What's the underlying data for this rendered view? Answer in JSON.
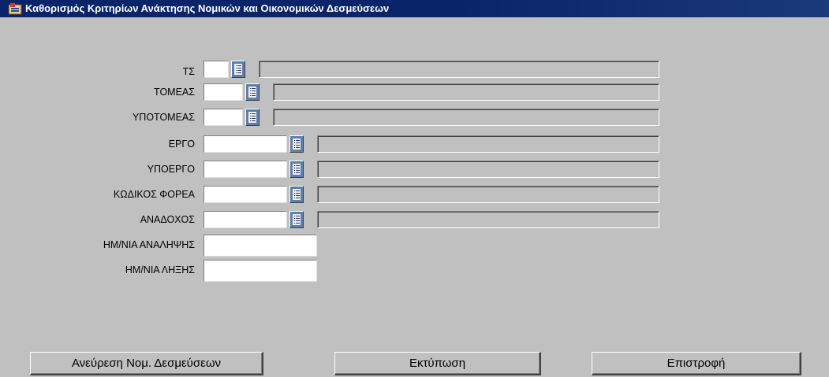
{
  "window": {
    "title": "Καθορισμός Κριτηρίων Ανάκτησης Νομικών και Οικονομικών Δεσμεύσεων",
    "icon": "app-form-icon"
  },
  "fields": [
    {
      "key": "ts",
      "label": "ΤΣ",
      "value": "",
      "has_lov": true
    },
    {
      "key": "tomeas",
      "label": "ΤΟΜΕΑΣ",
      "value": "",
      "has_lov": true
    },
    {
      "key": "ypotomeas",
      "label": "ΥΠΟΤΟΜΕΑΣ",
      "value": "",
      "has_lov": true
    },
    {
      "key": "ergo",
      "label": "ΕΡΓΟ",
      "value": "",
      "has_lov": true
    },
    {
      "key": "ypoergo",
      "label": "ΥΠΟΕΡΓΟ",
      "value": "",
      "has_lov": true
    },
    {
      "key": "kodikos_forea",
      "label": "ΚΩΔΙΚΟΣ ΦΟΡΕΑ",
      "value": "",
      "has_lov": true
    },
    {
      "key": "anadoxos",
      "label": "ΑΝΑΔΟΧΟΣ",
      "value": "",
      "has_lov": true
    },
    {
      "key": "imnia_analipsis",
      "label": "ΗΜ/ΝΙΑ ΑΝΑΛΗΨΗΣ",
      "value": "",
      "has_lov": false
    },
    {
      "key": "imnia_lixis",
      "label": "ΗΜ/ΝΙΑ ΛΗΞΗΣ",
      "value": "",
      "has_lov": false
    }
  ],
  "buttons": {
    "search": "Ανεύρεση Νομ. Δεσμεύσεων",
    "print": "Εκτύπωση",
    "back": "Επιστροφή"
  },
  "colors": {
    "titlebar": "#0a246a",
    "background": "#c0c0c0",
    "lov_button": "#5a7fb0"
  }
}
